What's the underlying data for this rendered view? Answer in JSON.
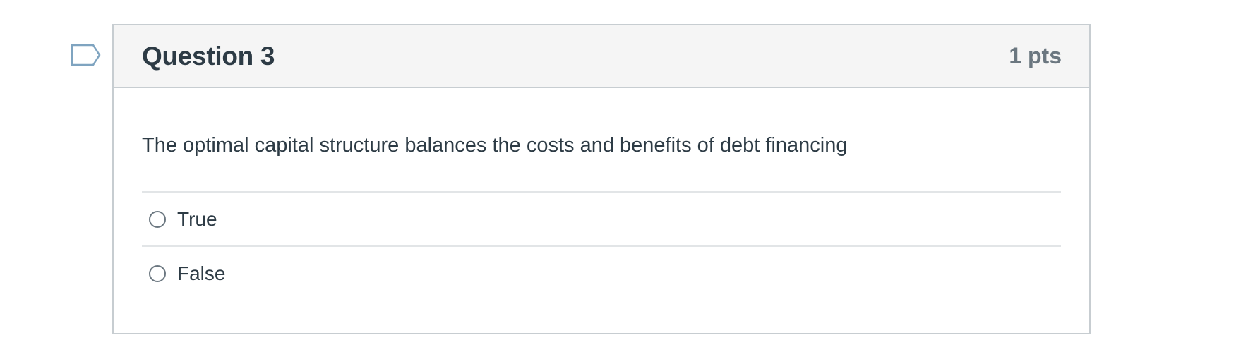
{
  "question": {
    "title": "Question 3",
    "points": "1 pts",
    "text": "The optimal capital structure balances the costs and benefits of debt financing",
    "answers": [
      {
        "label": "True",
        "selected": false
      },
      {
        "label": "False",
        "selected": false
      }
    ]
  },
  "icons": {
    "flag": "flag-question-icon"
  },
  "colors": {
    "text": "#2d3b45",
    "points": "#6b7780",
    "header_bg": "#f5f5f5",
    "border": "#c7cdd1",
    "flag": "#7fa4c0"
  }
}
